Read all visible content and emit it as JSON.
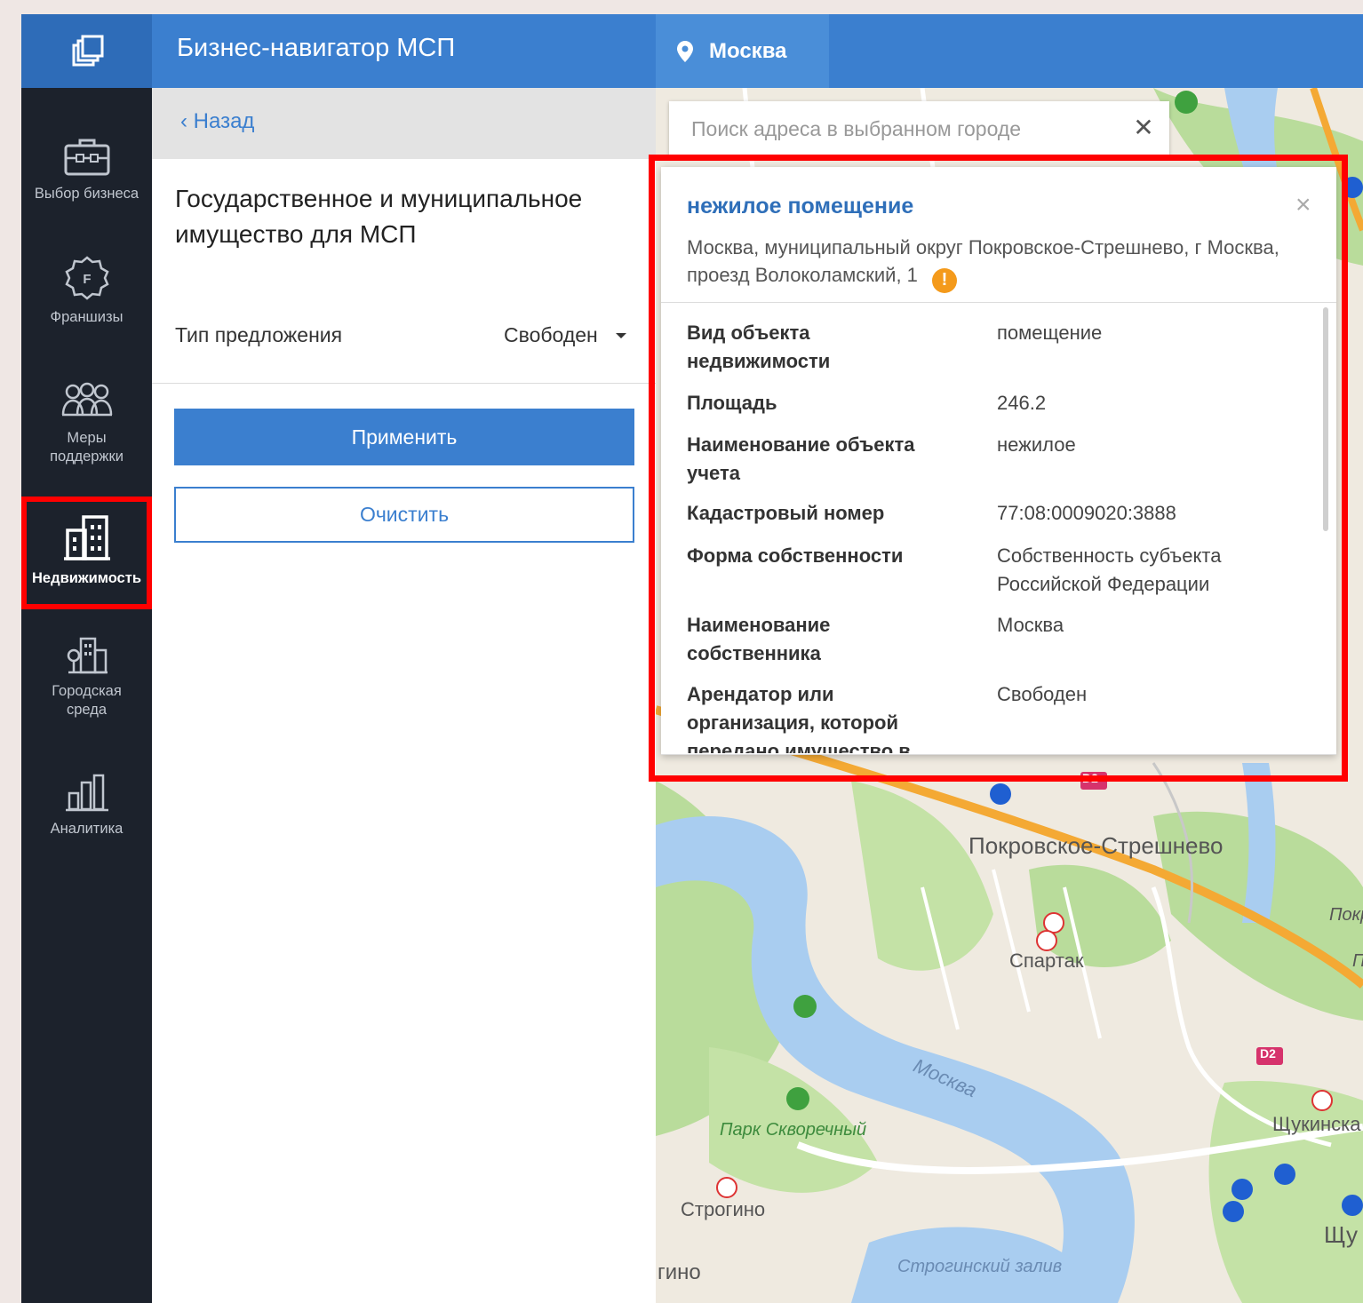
{
  "header": {
    "app_title": "Бизнес-навигатор МСП",
    "city": "Москва"
  },
  "sidebar": {
    "items": [
      {
        "label": "Выбор бизнеса",
        "icon": "briefcase-icon"
      },
      {
        "label": "Франшизы",
        "icon": "franchise-icon"
      },
      {
        "label": "Меры поддержки",
        "icon": "people-icon"
      },
      {
        "label": "Недвижимость",
        "icon": "building-icon",
        "active": true
      },
      {
        "label": "Городская среда",
        "icon": "city-icon"
      },
      {
        "label": "Аналитика",
        "icon": "analytics-icon"
      }
    ]
  },
  "panel": {
    "back_label": "‹  Назад",
    "title": "Государственное и муниципальное имущество для МСП",
    "offer_type_label": "Тип предложения",
    "offer_type_value": "Свободен",
    "apply_label": "Применить",
    "clear_label": "Очистить"
  },
  "map": {
    "search_placeholder": "Поиск адреса в выбранном городе",
    "labels": {
      "district": "Покровское-Стрешнево",
      "spartak": "Спартак",
      "river": "Москва",
      "park": "Парк Скворечный",
      "strogino": "Строгино",
      "strogino_cut": "гино",
      "bay": "Строгинский залив",
      "shchukinskaya": "Щукинска",
      "shchu": "Щу",
      "pokr_cut": "Покр",
      "p_cut": "П",
      "d2_top": "D2",
      "d2_bottom": "D2"
    }
  },
  "popup": {
    "title": "нежилое помещение",
    "address": "Москва, муниципальный округ Покровское-Стрешнево, г Москва, проезд Волоколамский, 1",
    "close_symbol": "×",
    "attributes": [
      {
        "key": "Вид объекта недвижимости",
        "value": "помещение"
      },
      {
        "key": "Площадь",
        "value": "246.2"
      },
      {
        "key": "Наименование объекта учета",
        "value": "нежилое"
      },
      {
        "key": "Кадастровый номер",
        "value": "77:08:0009020:3888"
      },
      {
        "key": "Форма собственности",
        "value": "Собственность субъекта Российской Федерации"
      },
      {
        "key": "Наименование собственника",
        "value": "Москва"
      },
      {
        "key": "Арендатор или организация, которой передано имущество в",
        "value": "Свободен"
      }
    ]
  },
  "colors": {
    "header_blue": "#3b7fcf",
    "sidebar_dark": "#1c222c",
    "highlight_red": "#ff0000",
    "warning_orange": "#f49a1b"
  }
}
